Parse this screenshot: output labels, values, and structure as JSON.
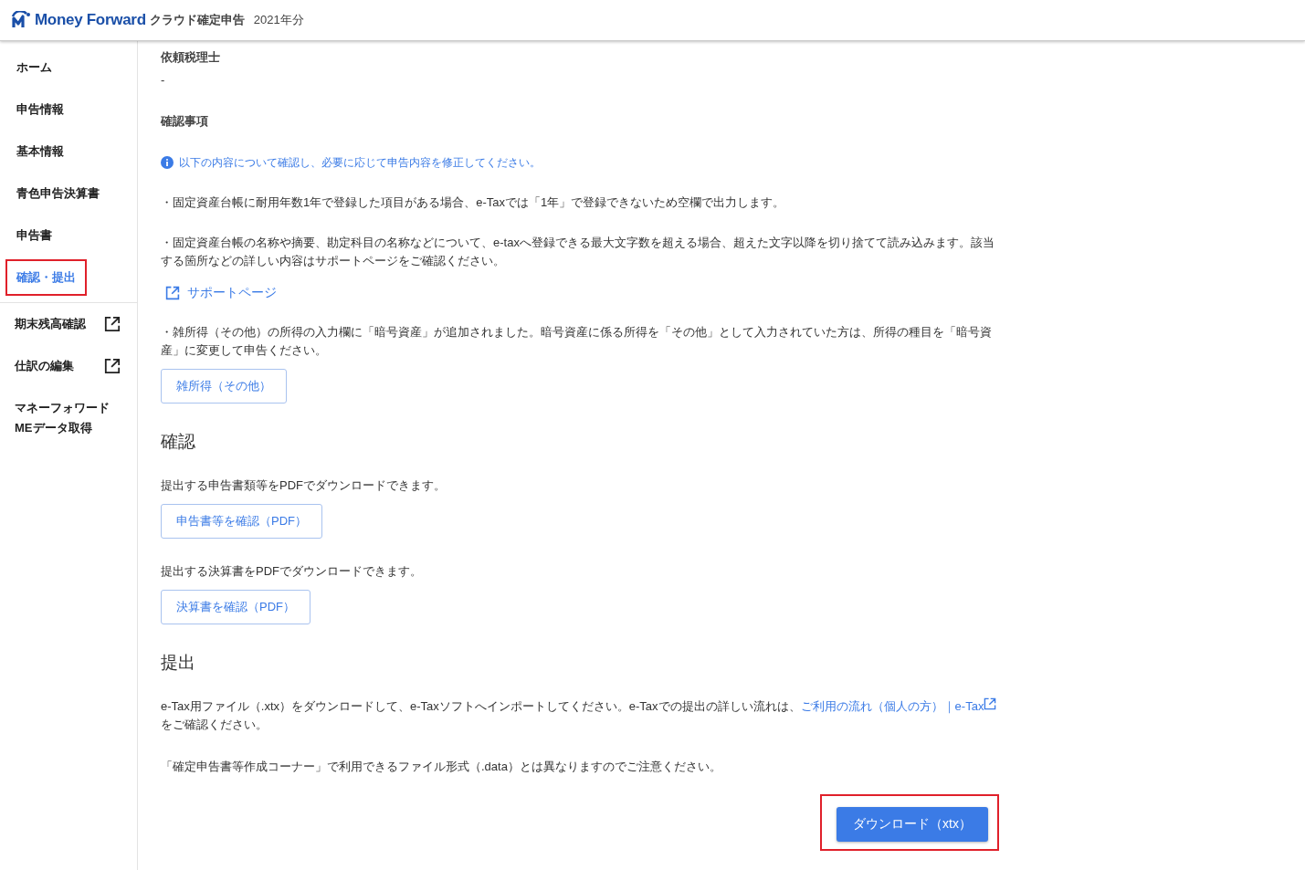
{
  "header": {
    "brand": "Money Forward",
    "product": "クラウド確定申告",
    "year": "2021年分"
  },
  "sidebar": {
    "items": [
      {
        "label": "ホーム",
        "selected": false,
        "highlighted": false
      },
      {
        "label": "申告情報",
        "selected": false,
        "highlighted": false
      },
      {
        "label": "基本情報",
        "selected": false,
        "highlighted": false
      },
      {
        "label": "青色申告決算書",
        "selected": false,
        "highlighted": false
      },
      {
        "label": "申告書",
        "selected": false,
        "highlighted": false
      },
      {
        "label": "確認・提出",
        "selected": true,
        "highlighted": true
      }
    ],
    "tools": [
      {
        "label": "期末残高確認",
        "external": true
      },
      {
        "label": "仕訳の編集",
        "external": true
      },
      {
        "label": "マネーフォワード\nMEデータ取得",
        "external": false
      }
    ]
  },
  "content": {
    "blocks": [
      {
        "kind": "label",
        "text": "依頼税理士"
      },
      {
        "kind": "value",
        "text": "-"
      },
      {
        "kind": "label",
        "text": "確認事項"
      },
      {
        "kind": "info",
        "text": "以下の内容について確認し、必要に応じて申告内容を修正してください。"
      },
      {
        "kind": "note",
        "text": "・固定資産台帳に耐用年数1年で登録した項目がある場合、e-Taxでは「1年」で登録できないため空欄で出力します。"
      },
      {
        "kind": "note",
        "text": "・固定資産台帳の名称や摘要、勘定科目の名称などについて、e-taxへ登録できる最大文字数を超える場合、超えた文字以降を切り捨てて読み込みます。該当する箇所などの詳しい内容はサポートページをご確認ください。"
      },
      {
        "kind": "link",
        "text": "サポートページ"
      },
      {
        "kind": "note",
        "text": "・雑所得（その他）の所得の入力欄に「暗号資産」が追加されました。暗号資産に係る所得を「その他」として入力されていた方は、所得の種目を「暗号資産」に変更して申告ください。"
      },
      {
        "kind": "button",
        "text": "雑所得（その他）"
      },
      {
        "kind": "heading",
        "text": "確認"
      },
      {
        "kind": "text",
        "text": "提出する申告書類等をPDFでダウンロードできます。"
      },
      {
        "kind": "button",
        "text": "申告書等を確認（PDF）"
      },
      {
        "kind": "text",
        "text": "提出する決算書をPDFでダウンロードできます。"
      },
      {
        "kind": "button",
        "text": "決算書を確認（PDF）"
      },
      {
        "kind": "heading",
        "text": "提出"
      },
      {
        "kind": "text_link",
        "before": "e-Tax用ファイル（.xtx）をダウンロードして、e-Taxソフトへインポートしてください。e-Taxでの提出の詳しい流れは、",
        "link": "ご利用の流れ（個人の方）｜e-Tax",
        "after": "をご確認ください。"
      },
      {
        "kind": "text",
        "text": "「確定申告書等作成コーナー」で利用できるファイル形式（.data）とは異なりますのでご注意ください。"
      },
      {
        "kind": "primary_button",
        "text": "ダウンロード（xtx）",
        "highlighted": true
      }
    ]
  }
}
